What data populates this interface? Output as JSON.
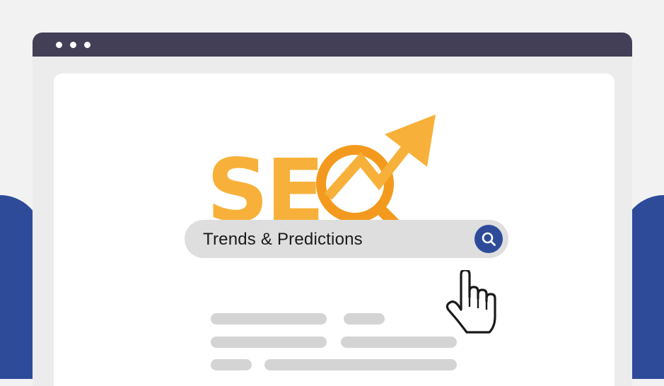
{
  "colors": {
    "background": "#f2f2f2",
    "side_shape": "#2e4b9a",
    "titlebar": "#433f57",
    "logo_orange": "#f7b13a",
    "magnifier_orange": "#f39a1e",
    "search_button": "#2e4b9a",
    "placeholder_lines": "#d4d4d4"
  },
  "icons": {
    "window_controls": [
      "window-dot-icon",
      "window-dot-icon",
      "window-dot-icon"
    ],
    "logo": "seo-magnifier-arrow-logo",
    "search": "search-icon",
    "cursor": "hand-pointer-icon"
  },
  "logo": {
    "text": "SE"
  },
  "search": {
    "value": "Trends & Predictions"
  }
}
